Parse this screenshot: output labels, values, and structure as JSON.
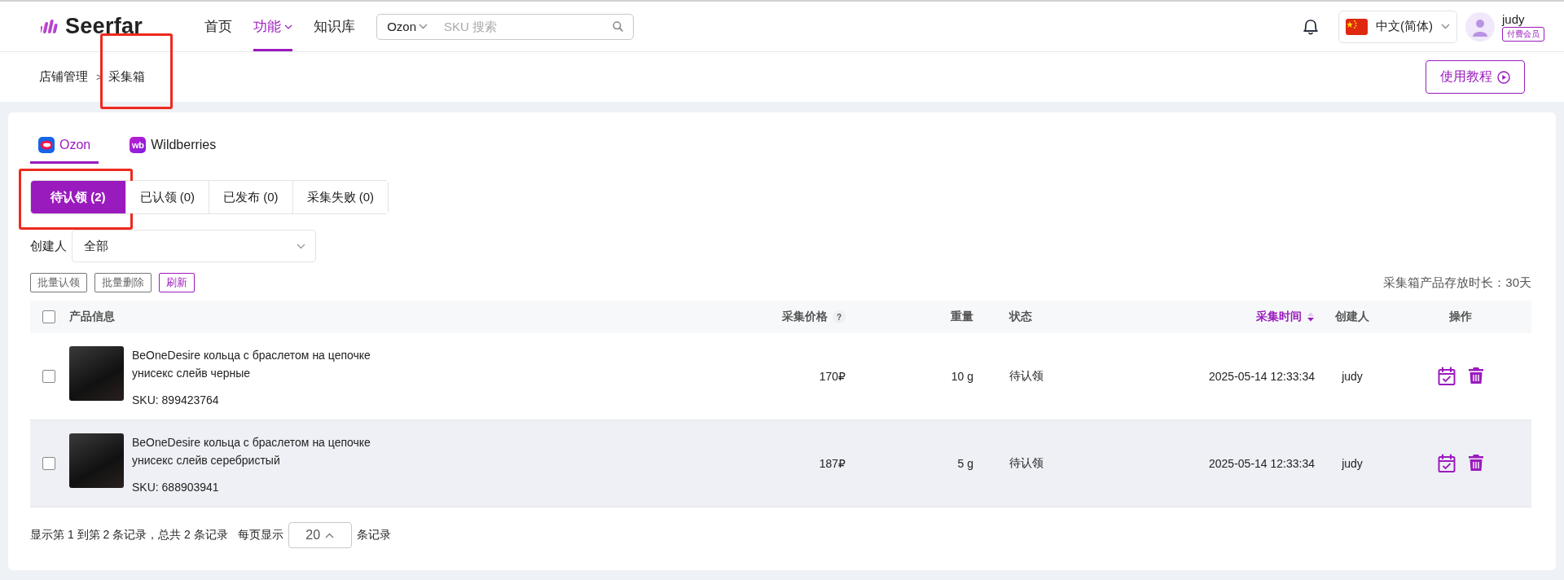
{
  "header": {
    "logo": "Seerfar",
    "nav": [
      {
        "label": "首页",
        "selected": false,
        "dropdown": false
      },
      {
        "label": "功能",
        "selected": true,
        "dropdown": true
      },
      {
        "label": "知识库",
        "selected": false,
        "dropdown": false
      }
    ],
    "search": {
      "platform": "Ozon",
      "placeholder": "SKU 搜索"
    },
    "language": "中文(简体)",
    "user": {
      "name": "judy",
      "badge": "付费会员"
    }
  },
  "breadcrumb": {
    "separator": ">",
    "items": [
      {
        "label": "店铺管理",
        "highlighted": false
      },
      {
        "label": "采集箱",
        "highlighted": true
      }
    ]
  },
  "tutorial_button": "使用教程",
  "platform_tabs": [
    {
      "label": "Ozon",
      "kind": "ozon",
      "selected": true
    },
    {
      "label": "Wildberries",
      "kind": "wb",
      "icon_text": "wb",
      "selected": false
    }
  ],
  "status_tabs": [
    {
      "label": "待认领 (2)",
      "selected": true,
      "highlighted": true
    },
    {
      "label": "已认领 (0)",
      "selected": false,
      "highlighted": false
    },
    {
      "label": "已发布 (0)",
      "selected": false,
      "highlighted": false
    },
    {
      "label": "采集失败 (0)",
      "selected": false,
      "highlighted": false
    }
  ],
  "filter": {
    "label": "创建人",
    "value": "全部"
  },
  "actions": [
    {
      "label": "批量认领",
      "kind": "default"
    },
    {
      "label": "批量删除",
      "kind": "default"
    },
    {
      "label": "刷新",
      "kind": "primary"
    }
  ],
  "retention_note": "采集箱产品存放时长：30天",
  "table": {
    "select_all_checked": false,
    "columns": [
      {
        "label": "产品信息"
      },
      {
        "label": "采集价格",
        "help_mark": "?"
      },
      {
        "label": "重量"
      },
      {
        "label": "状态"
      },
      {
        "label": "采集时间",
        "sorted_descending": true
      },
      {
        "label": "创建人"
      },
      {
        "label": "操作"
      }
    ],
    "rows": [
      {
        "checked": false,
        "hovered": false,
        "title": "BeOneDesire кольца с браслетом на цепочке унисекс слейв черные",
        "sku": "SKU: 899423764",
        "price": "170₽",
        "weight": "10 g",
        "status": "待认领",
        "time": "2025-05-14 12:33:34",
        "creator": "judy"
      },
      {
        "checked": false,
        "hovered": true,
        "title": "BeOneDesire кольца с браслетом на цепочке унисекс слейв серебристый",
        "sku": "SKU: 688903941",
        "price": "187₽",
        "weight": "5 g",
        "status": "待认领",
        "time": "2025-05-14 12:33:34",
        "creator": "judy"
      }
    ]
  },
  "pagination": {
    "summary": "显示第 1 到第 2 条记录，总共 2 条记录",
    "per_page_label": "每页显示",
    "page_size": "20",
    "suffix": "条记录"
  }
}
